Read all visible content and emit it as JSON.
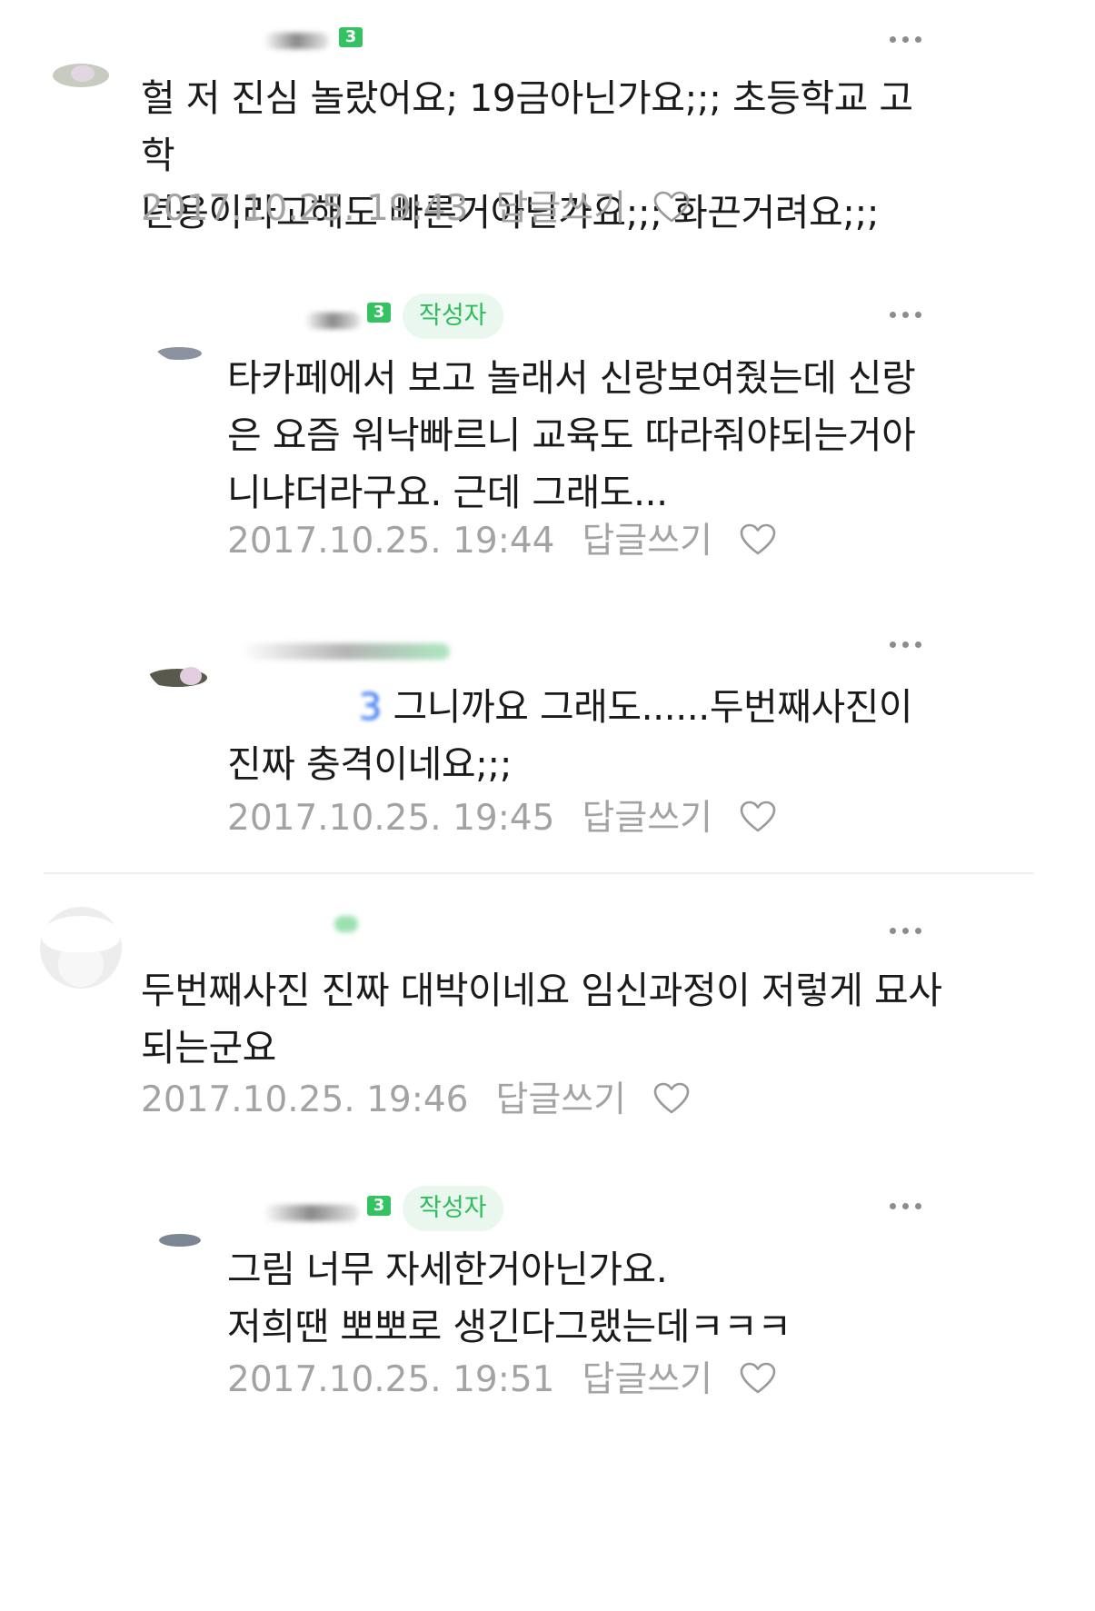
{
  "colors": {
    "accent_green": "#35c262",
    "author_badge_bg": "#e9f7ee",
    "meta_gray": "#a3a3a3",
    "mention_blue": "#2b6ef2"
  },
  "comments": [
    {
      "level": "3",
      "text_lines": [
        "헐 저 진심 놀랐어요; 19금아닌가요;;; 초등학교 고학",
        "년용이라고해도 빠른거아닌가요;;; 화끈거려요;;;"
      ],
      "date": "2017.10.25. 19:43",
      "reply_label": "답글쓰기",
      "icons": [
        "more-icon",
        "heart-icon"
      ]
    },
    {
      "level": "3",
      "author_badge": "작성자",
      "text_lines": [
        "타카페에서 보고 놀래서 신랑보여줬는데 신랑",
        "은 요즘 워낙빠르니 교육도 따라줘야되는거아",
        "니냐더라구요. 근데 그래도..."
      ],
      "date": "2017.10.25. 19:44",
      "reply_label": "답글쓰기"
    },
    {
      "mention": "3",
      "text_lines": [
        "그니까요 그래도......두번째사진이",
        "진짜 충격이네요;;;"
      ],
      "date": "2017.10.25. 19:45",
      "reply_label": "답글쓰기"
    },
    {
      "text_lines": [
        "두번째사진 진짜 대박이네요 임신과정이 저렇게 묘사",
        "되는군요"
      ],
      "date": "2017.10.25. 19:46",
      "reply_label": "답글쓰기"
    },
    {
      "level": "3",
      "author_badge": "작성자",
      "text_lines": [
        "그림 너무 자세한거아닌가요.",
        "저희땐 뽀뽀로 생긴다그랬는데ㅋㅋㅋ"
      ],
      "date": "2017.10.25. 19:51",
      "reply_label": "답글쓰기"
    }
  ]
}
